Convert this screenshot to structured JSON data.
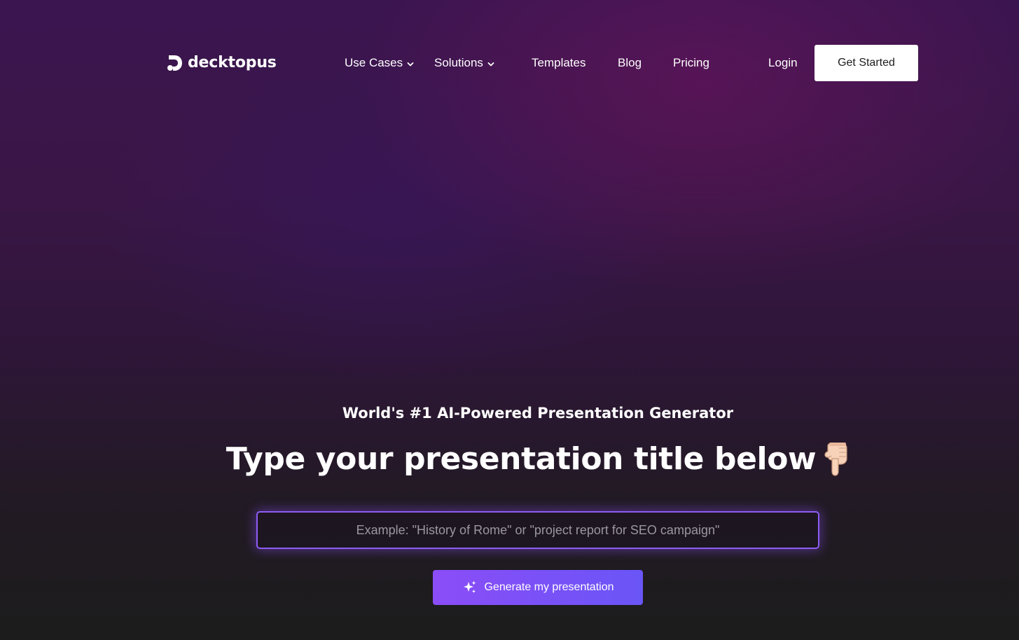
{
  "brand": {
    "name": "decktopus",
    "logo_icon": "decktopus-logo-icon"
  },
  "nav": {
    "items": [
      {
        "label": "Use Cases",
        "has_dropdown": true
      },
      {
        "label": "Solutions",
        "has_dropdown": true
      },
      {
        "label": "Templates",
        "has_dropdown": false
      },
      {
        "label": "Blog",
        "has_dropdown": false
      },
      {
        "label": "Pricing",
        "has_dropdown": false
      }
    ],
    "login_label": "Login",
    "cta_label": "Get Started"
  },
  "hero": {
    "eyebrow": "World's #1 AI-Powered Presentation Generator",
    "headline": "Type your presentation title below",
    "headline_icon": "pointing-down-hand-icon",
    "input_placeholder": "Example: \"History of Rome\" or \"project report for SEO campaign\"",
    "input_value": "",
    "generate_label": "Generate my presentation",
    "generate_icon": "sparkle-icon"
  },
  "colors": {
    "accent_purple": "#8b4df7",
    "accent_blue": "#6a55f7",
    "input_border": "#8f5cf5",
    "cta_background": "#ffffff",
    "background_top": "#3b1550",
    "background_bottom": "#1c1c1c"
  }
}
